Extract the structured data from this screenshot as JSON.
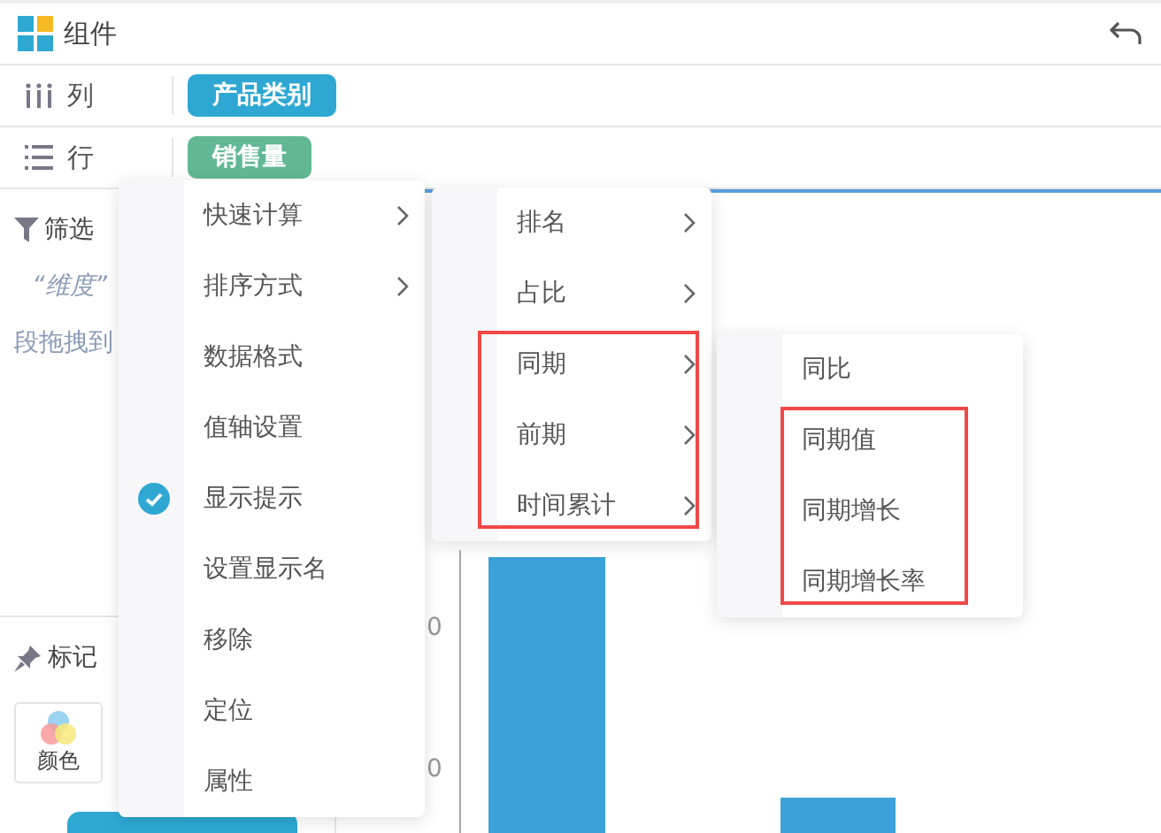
{
  "header": {
    "title": "组件"
  },
  "shelves": [
    {
      "label": "列",
      "kind": "columns",
      "chip": {
        "text": "产品类别",
        "color": "#2ea8d3"
      }
    },
    {
      "label": "行",
      "kind": "rows",
      "chip": {
        "text": "销售量",
        "color": "#62b894"
      }
    }
  ],
  "side_panel": {
    "filter": {
      "title": "筛选",
      "hint_quote": "“维度”",
      "hint_text": "段拖拽到"
    },
    "marks": {
      "title": "标记",
      "buttons": [
        {
          "label": "颜色"
        }
      ]
    }
  },
  "chart": {
    "axis_labels": [
      "0",
      "0"
    ]
  },
  "menus": [
    {
      "items": [
        {
          "label": "快速计算",
          "has_submenu": true,
          "checked": false
        },
        {
          "label": "排序方式",
          "has_submenu": true,
          "checked": false
        },
        {
          "label": "数据格式",
          "has_submenu": false,
          "checked": false
        },
        {
          "label": "值轴设置",
          "has_submenu": false,
          "checked": false
        },
        {
          "label": "显示提示",
          "has_submenu": false,
          "checked": true
        },
        {
          "label": "设置显示名",
          "has_submenu": false,
          "checked": false
        },
        {
          "label": "移除",
          "has_submenu": false,
          "checked": false
        },
        {
          "label": "定位",
          "has_submenu": false,
          "checked": false
        },
        {
          "label": "属性",
          "has_submenu": false,
          "checked": false
        }
      ]
    },
    {
      "items": [
        {
          "label": "排名",
          "has_submenu": true,
          "highlighted": false
        },
        {
          "label": "占比",
          "has_submenu": true,
          "highlighted": false
        },
        {
          "label": "同期",
          "has_submenu": true,
          "highlighted": true
        },
        {
          "label": "前期",
          "has_submenu": true,
          "highlighted": true
        },
        {
          "label": "时间累计",
          "has_submenu": true,
          "highlighted": true
        }
      ]
    },
    {
      "items": [
        {
          "label": "同比",
          "has_submenu": false,
          "highlighted": false
        },
        {
          "label": "同期值",
          "has_submenu": false,
          "highlighted": true
        },
        {
          "label": "同期增长",
          "has_submenu": false,
          "highlighted": true
        },
        {
          "label": "同期增长率",
          "has_submenu": false,
          "highlighted": true
        }
      ]
    }
  ]
}
